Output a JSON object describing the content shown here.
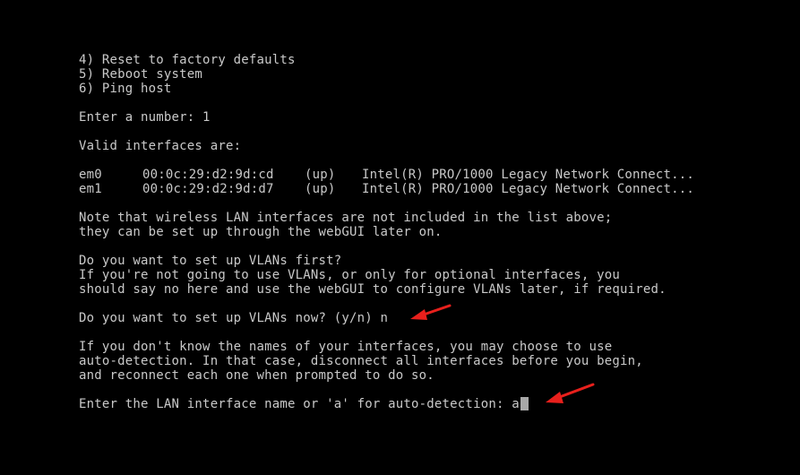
{
  "menu": {
    "item4": "4) Reset to factory defaults",
    "item5": "5) Reboot system",
    "item6": "6) Ping host"
  },
  "number_prompt": "Enter a number: 1",
  "valid_interfaces_label": "Valid interfaces are:",
  "interfaces": [
    {
      "name": "em0",
      "mac": "00:0c:29:d2:9d:cd",
      "status": "(up)",
      "description": "Intel(R) PRO/1000 Legacy Network Connect..."
    },
    {
      "name": "em1",
      "mac": "00:0c:29:d2:9d:d7",
      "status": "(up)",
      "description": "Intel(R) PRO/1000 Legacy Network Connect..."
    }
  ],
  "wireless_note": [
    "Note that wireless LAN interfaces are not included in the list above;",
    "they can be set up through the webGUI later on."
  ],
  "vlan_info": [
    "Do you want to set up VLANs first?",
    "If you're not going to use VLANs, or only for optional interfaces, you",
    "should say no here and use the webGUI to configure VLANs later, if required."
  ],
  "vlan_prompt": "Do you want to set up VLANs now? (y/n) n",
  "autodetect_info": [
    "If you don't know the names of your interfaces, you may choose to use",
    "auto-detection. In that case, disconnect all interfaces before you begin,",
    "and reconnect each one when prompted to do so."
  ],
  "lan_prompt": "Enter the LAN interface name or 'a' for auto-detection: a",
  "colors": {
    "background": "#000000",
    "text": "#c9c9c9",
    "cursor": "#a8a8a8",
    "annotation_arrow": "#e8201c"
  },
  "icons": {
    "annotation": "red-arrow-icon",
    "cursor": "block-cursor"
  }
}
